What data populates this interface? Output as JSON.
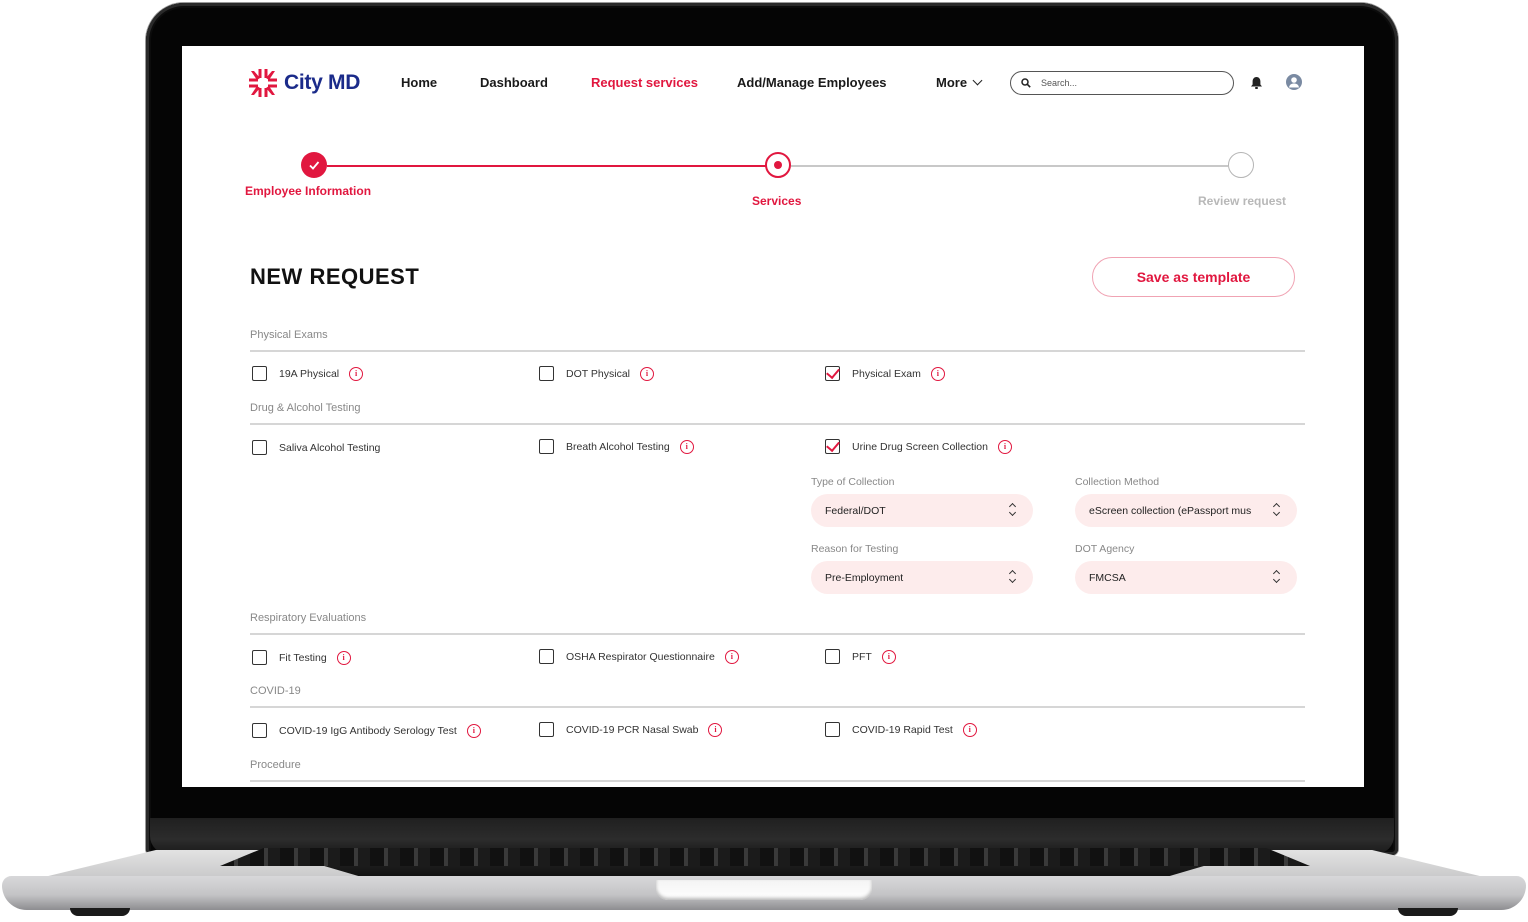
{
  "brand": {
    "name": "City MD",
    "logo_icon": "citymd-star-logo",
    "accent_color": "#e1173f",
    "brand_blue": "#1b2b8a"
  },
  "nav": {
    "items": [
      {
        "label": "Home",
        "active": false
      },
      {
        "label": "Dashboard",
        "active": false
      },
      {
        "label": "Request services",
        "active": true
      },
      {
        "label": "Add/Manage Employees",
        "active": false
      }
    ],
    "more_label": "More",
    "search_placeholder": "Search...",
    "search_value": "",
    "icons": [
      "search-icon",
      "bell-icon",
      "user-avatar-icon"
    ]
  },
  "stepper": {
    "steps": [
      {
        "label": "Employee Information",
        "state": "completed"
      },
      {
        "label": "Services",
        "state": "current"
      },
      {
        "label": "Review request",
        "state": "upcoming"
      }
    ]
  },
  "page": {
    "title": "NEW REQUEST",
    "save_template_label": "Save as template"
  },
  "sections": [
    {
      "label": "Physical Exams",
      "options": [
        {
          "label": "19A Physical",
          "checked": false,
          "info": true
        },
        {
          "label": "DOT Physical",
          "checked": false,
          "info": true
        },
        {
          "label": "Physical Exam",
          "checked": true,
          "info": true
        }
      ]
    },
    {
      "label": "Drug & Alcohol Testing",
      "options": [
        {
          "label": "Saliva Alcohol Testing",
          "checked": false,
          "info": false
        },
        {
          "label": "Breath Alcohol Testing",
          "checked": false,
          "info": true
        },
        {
          "label": "Urine Drug Screen Collection",
          "checked": true,
          "info": true
        }
      ],
      "fields": [
        {
          "label": "Type of Collection",
          "value": "Federal/DOT"
        },
        {
          "label": "Collection Method",
          "value": "eScreen collection (ePassport mus"
        },
        {
          "label": "Reason for Testing",
          "value": "Pre-Employment"
        },
        {
          "label": "DOT Agency",
          "value": "FMCSA"
        }
      ]
    },
    {
      "label": "Respiratory Evaluations",
      "options": [
        {
          "label": "Fit Testing",
          "checked": false,
          "info": true
        },
        {
          "label": "OSHA Respirator Questionnaire",
          "checked": false,
          "info": true
        },
        {
          "label": "PFT",
          "checked": false,
          "info": true
        }
      ]
    },
    {
      "label": "COVID-19",
      "options": [
        {
          "label": "COVID-19 IgG Antibody Serology Test",
          "checked": false,
          "info": true
        },
        {
          "label": "COVID-19 PCR Nasal Swab",
          "checked": false,
          "info": true
        },
        {
          "label": "COVID-19 Rapid Test",
          "checked": false,
          "info": true
        }
      ]
    },
    {
      "label": "Procedure",
      "options": []
    }
  ]
}
